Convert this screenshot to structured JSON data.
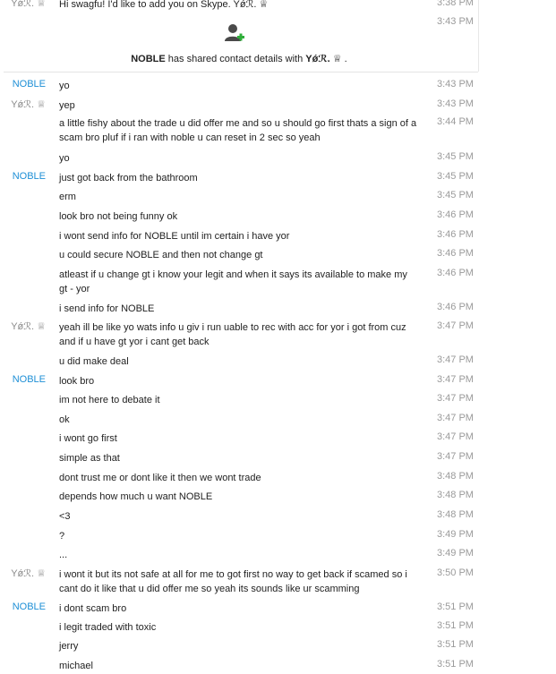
{
  "header_message": {
    "sender": "Yǿℛ. ♕",
    "text": "Hi swagfu! I'd like to add you on Skype. Yǿℛ. ♕",
    "time": "3:38 PM"
  },
  "contact_share": {
    "time": "3:43 PM",
    "who": "NOBLE",
    "text": " has shared contact details with ",
    "target": "Yǿℛ. ♕",
    "end": " ."
  },
  "messages": [
    {
      "sender": "NOBLE",
      "text": "yo",
      "time": "3:43 PM"
    },
    {
      "sender": "Yǿℛ. ♕",
      "text": "yep",
      "time": "3:43 PM"
    },
    {
      "sender": "",
      "text": "a little fishy about the trade u did offer me and so u should go first thats a sign of a scam bro pluf if i ran with noble u can reset in 2 sec so yeah",
      "time": "3:44 PM"
    },
    {
      "sender": "",
      "text": "yo",
      "time": "3:45 PM"
    },
    {
      "sender": "NOBLE",
      "text": "just got back from the bathroom",
      "time": "3:45 PM"
    },
    {
      "sender": "",
      "text": "erm",
      "time": "3:45 PM"
    },
    {
      "sender": "",
      "text": "look bro not being funny ok",
      "time": "3:46 PM"
    },
    {
      "sender": "",
      "text": "i wont send info for NOBLE until im certain i have yor",
      "time": "3:46 PM"
    },
    {
      "sender": "",
      "text": "u could secure NOBLE and then not change gt",
      "time": "3:46 PM"
    },
    {
      "sender": "",
      "text": "atleast if u change gt i know your legit and when it says its available to make my gt - yor",
      "time": "3:46 PM"
    },
    {
      "sender": "",
      "text": "i send info for NOBLE",
      "time": "3:46 PM"
    },
    {
      "sender": "Yǿℛ. ♕",
      "text": "yeah ill be like yo wats info u giv i run uable to rec with acc for yor i got from cuz and if u have gt yor i cant get back",
      "time": "3:47 PM"
    },
    {
      "sender": "",
      "text": "u did make deal",
      "time": "3:47 PM"
    },
    {
      "sender": "NOBLE",
      "text": "look bro",
      "time": "3:47 PM"
    },
    {
      "sender": "",
      "text": "im not here to debate it",
      "time": "3:47 PM"
    },
    {
      "sender": "",
      "text": "ok",
      "time": "3:47 PM"
    },
    {
      "sender": "",
      "text": "i wont go first",
      "time": "3:47 PM"
    },
    {
      "sender": "",
      "text": "simple as that",
      "time": "3:47 PM"
    },
    {
      "sender": "",
      "text": "dont trust me or dont like it then we wont trade",
      "time": "3:48 PM"
    },
    {
      "sender": "",
      "text": "depends how much u want NOBLE",
      "time": "3:48 PM"
    },
    {
      "sender": "",
      "text": "<3",
      "time": "3:48 PM"
    },
    {
      "sender": "",
      "text": "?",
      "time": "3:49 PM"
    },
    {
      "sender": "",
      "text": "...",
      "time": "3:49 PM"
    },
    {
      "sender": "Yǿℛ. ♕",
      "text": "i wont it but its not safe at all for me to got first no way to get back if scamed so i cant do it like that u did offer me so yeah its sounds like ur scamming",
      "time": "3:50 PM"
    },
    {
      "sender": "NOBLE",
      "text": "i dont scam bro",
      "time": "3:51 PM"
    },
    {
      "sender": "",
      "text": "i legit traded with toxic",
      "time": "3:51 PM"
    },
    {
      "sender": "",
      "text": "jerry",
      "time": "3:51 PM"
    },
    {
      "sender": "",
      "text": "michael",
      "time": "3:51 PM"
    }
  ]
}
